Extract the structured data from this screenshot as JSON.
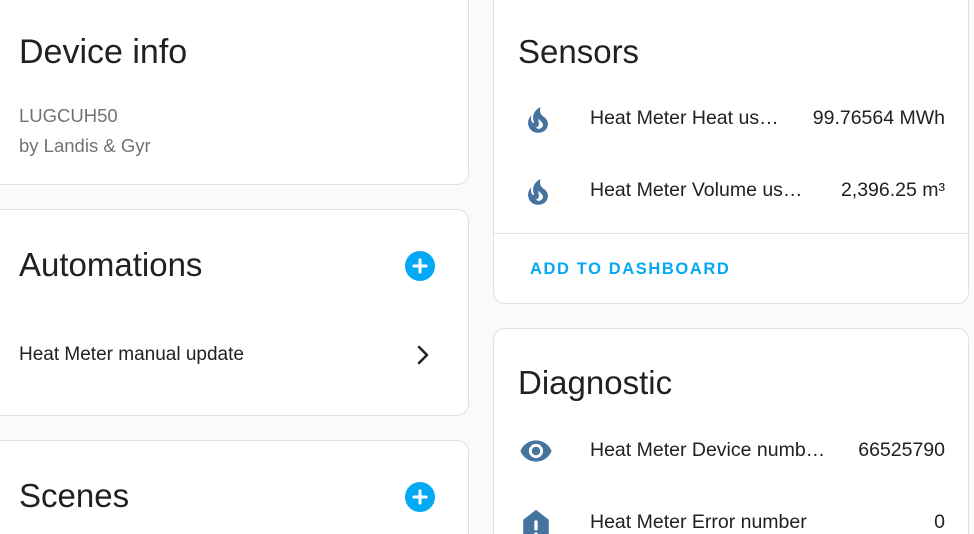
{
  "device_info": {
    "title": "Device info",
    "model": "LUGCUH50",
    "manufacturer": "by Landis & Gyr"
  },
  "automations": {
    "title": "Automations",
    "items": [
      {
        "label": "Heat Meter manual update"
      }
    ]
  },
  "scenes": {
    "title": "Scenes"
  },
  "sensors": {
    "title": "Sensors",
    "items": [
      {
        "name": "Heat Meter Heat us…",
        "value": "99.76564 MWh",
        "icon": "fire-icon"
      },
      {
        "name": "Heat Meter Volume us…",
        "value": "2,396.25 m³",
        "icon": "fire-icon"
      }
    ],
    "add_to_dashboard": "ADD TO DASHBOARD"
  },
  "diagnostic": {
    "title": "Diagnostic",
    "items": [
      {
        "name": "Heat Meter Device numb…",
        "value": "66525790",
        "icon": "eye-icon"
      },
      {
        "name": "Heat Meter Error number",
        "value": "0",
        "icon": "alert-icon"
      }
    ]
  },
  "colors": {
    "accent": "#03a9f4",
    "icon": "#44739e",
    "card_border": "#e0e0e0",
    "background": "#fafafa"
  }
}
